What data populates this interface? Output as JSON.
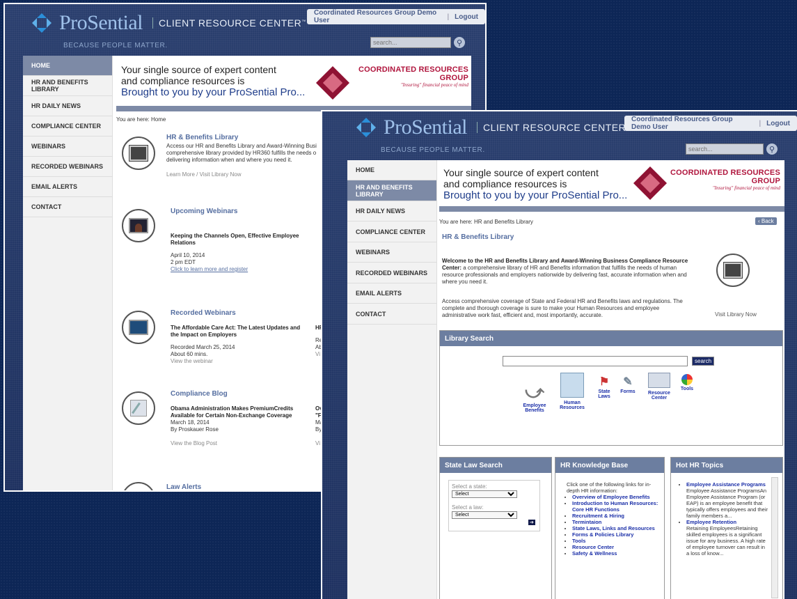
{
  "brand": {
    "name": "ProSential",
    "product": "CLIENT RESOURCE CENTER",
    "trademark": "™",
    "tagline": "BECAUSE PEOPLE MATTER."
  },
  "header": {
    "user": "Coordinated Resources Group Demo User",
    "separator": "|",
    "logout": "Logout",
    "search_placeholder": "search...",
    "search_icon": "magnifier-icon"
  },
  "banner": {
    "line1": "Your single source of expert content",
    "line2": "and compliance resources is",
    "line3": "Brought to you by your ProSential Pro...",
    "partner": "COORDINATED RESOURCES GROUP",
    "partner_motto": "\"Insuring\" financial peace of mind"
  },
  "nav": {
    "items": [
      "HOME",
      "HR AND BENEFITS LIBRARY",
      "HR DAILY NEWS",
      "COMPLIANCE CENTER",
      "WEBINARS",
      "RECORDED WEBINARS",
      "EMAIL ALERTS",
      "CONTACT"
    ]
  },
  "home": {
    "breadcrumb": "You are here: Home",
    "library": {
      "title": "HR & Benefits Library",
      "text": "Access our HR and Benefits Library and Award-Winning Busi comprehensive library provided by HR360 fulfills the needs o delivering information when and where you need it.",
      "learn": "Learn More",
      "sep": "/",
      "visit": "Visit Library Now"
    },
    "webinars": {
      "title": "Upcoming Webinars",
      "item": "Keeping the Channels Open, Effective Employee Relations",
      "date": "April 10, 2014",
      "time": "2 pm EDT",
      "link": "Click to learn more and register"
    },
    "recorded": {
      "title": "Recorded Webinars",
      "item": "The Affordable Care Act: The Latest Updates and the Impact on Employers",
      "date": "Recorded March 25, 2014",
      "duration": "About 60 mins.",
      "link": "View the webinar",
      "cut_title": "HF",
      "cut_date": "Re",
      "cut_duration": "Ab",
      "cut_link": "Vi"
    },
    "blog": {
      "title": "Compliance Blog",
      "item": "Obama Administration Makes PremiumCredits Available for Certain Non-Exchange Coverage",
      "date": "March 18, 2014",
      "author": "By Proskauer Rose",
      "link": "View the Blog Post",
      "cut_title1": "Ov",
      "cut_title2": "\"F",
      "cut_date": "Ma",
      "cut_author": "By",
      "cut_link": "Vi"
    },
    "alerts": {
      "title": "Law Alerts"
    }
  },
  "library": {
    "breadcrumb": "You are here: HR and Benefits Library",
    "back": "‹ Back",
    "title": "HR & Benefits Library",
    "intro_bold": "Welcome to the HR and Benefits Library and Award-Winning Business Compliance Resource Center:",
    "intro_text": " a comprehensive library of HR and Benefits information that fulfills the needs of human resource professionals and employers nationwide by delivering fast, accurate information when and where you need it.",
    "coverage": "Access comprehensive coverage of State and Federal HR and Benefits laws and regulations. The complete and thorough coverage is sure to make your Human Resources and employee administrative work fast, efficient and, most importantly, accurate.",
    "visit": "Visit Library Now",
    "search_title": "Library Search",
    "search_button": "search",
    "tools": [
      {
        "label1": "Employee",
        "label2": "Benefits",
        "icon": "stethoscope-icon"
      },
      {
        "label1": "Human",
        "label2": "Resources",
        "icon": "org-chart-icon"
      },
      {
        "label1": "State",
        "label2": "Laws",
        "icon": "flag-icon"
      },
      {
        "label1": "Forms",
        "label2": "",
        "icon": "forms-icon"
      },
      {
        "label1": "Resource",
        "label2": "Center",
        "icon": "books-icon"
      },
      {
        "label1": "Tools",
        "label2": "",
        "icon": "pie-chart-icon"
      }
    ],
    "state_law": {
      "title": "State Law Search",
      "state_label": "Select a state:",
      "state_value": "Select",
      "law_label": "Select a law:",
      "law_value": "Select",
      "go": "➔"
    },
    "knowledge": {
      "title": "HR Knowledge Base",
      "intro": "Click one of the following links for in-depth HR information:",
      "links": [
        "Overview of Employee Benefits",
        "Introduction to Human Resources: Core HR Functions",
        "Recruitment & Hiring",
        "Termintaion",
        "State Laws, Links and Resources",
        "Forms & Policies Library",
        "Tools",
        "Resource Center",
        "Safety & Wellness"
      ]
    },
    "hot": {
      "title": "Hot HR Topics",
      "items": [
        {
          "link": "Employee Assistance Programs",
          "text": "Employee Assistance ProgramsAn Employee Assistance Program (or EAP) is an employee benefit that typically offers employees and their family members a..."
        },
        {
          "link": "Employee Retention",
          "text": "Retaining EmployeesRetaining skilled employees is a significant issue for any business. A high rate of employee turnover can result in a loss of know..."
        }
      ]
    }
  },
  "colors": {
    "page_bg": "#0d2656",
    "accent": "#7d8aa6",
    "link": "#1b2fa8",
    "partner": "#b0153d"
  }
}
